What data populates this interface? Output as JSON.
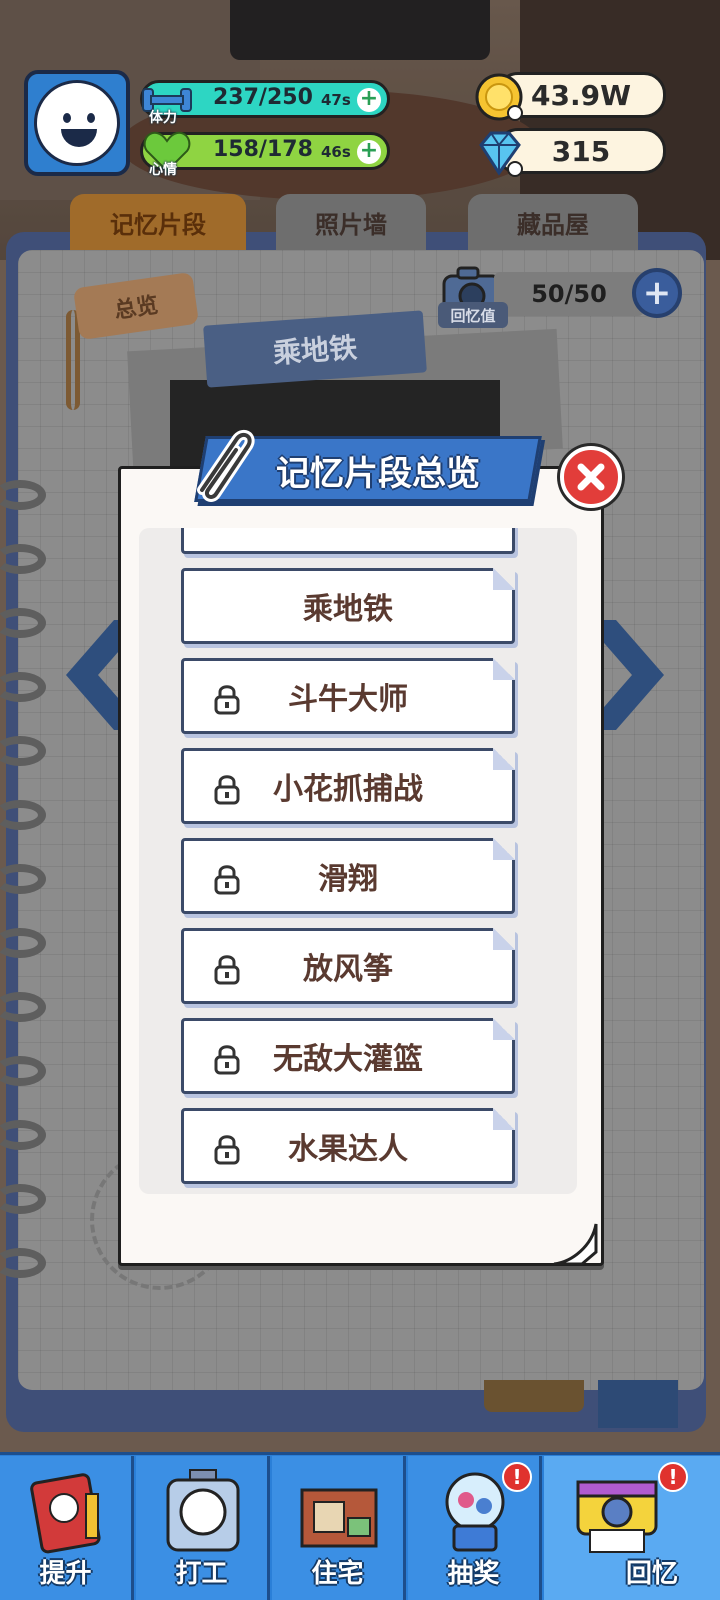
{
  "hud": {
    "energy": {
      "label": "体力",
      "value": "237/250",
      "timer": "47s"
    },
    "mood": {
      "label": "心情",
      "value": "158/178",
      "timer": "46s"
    },
    "coins": "43.9W",
    "gems": "315"
  },
  "tabs": [
    "记忆片段",
    "照片墙",
    "藏品屋"
  ],
  "background": {
    "overview_tag": "总览",
    "recall_label": "回忆值",
    "recall_value": "50/50",
    "photo_banner": "乘地铁"
  },
  "modal": {
    "title": "记忆片段总览",
    "items": [
      {
        "label": "乘地铁",
        "locked": false
      },
      {
        "label": "斗牛大师",
        "locked": true
      },
      {
        "label": "小花抓捕战",
        "locked": true
      },
      {
        "label": "滑翔",
        "locked": true
      },
      {
        "label": "放风筝",
        "locked": true
      },
      {
        "label": "无敌大灌篮",
        "locked": true
      },
      {
        "label": "水果达人",
        "locked": true
      }
    ]
  },
  "bottom_nav": [
    {
      "label": "提升",
      "badge": ""
    },
    {
      "label": "打工",
      "badge": ""
    },
    {
      "label": "住宅",
      "badge": ""
    },
    {
      "label": "抽奖",
      "badge": "!"
    },
    {
      "label": "回忆",
      "badge": "!"
    }
  ],
  "colors": {
    "accent_blue": "#3a76c8",
    "energy": "#2dd6c3",
    "mood": "#8fd442",
    "close_red": "#e23d3a",
    "item_text": "#5a3a30"
  }
}
